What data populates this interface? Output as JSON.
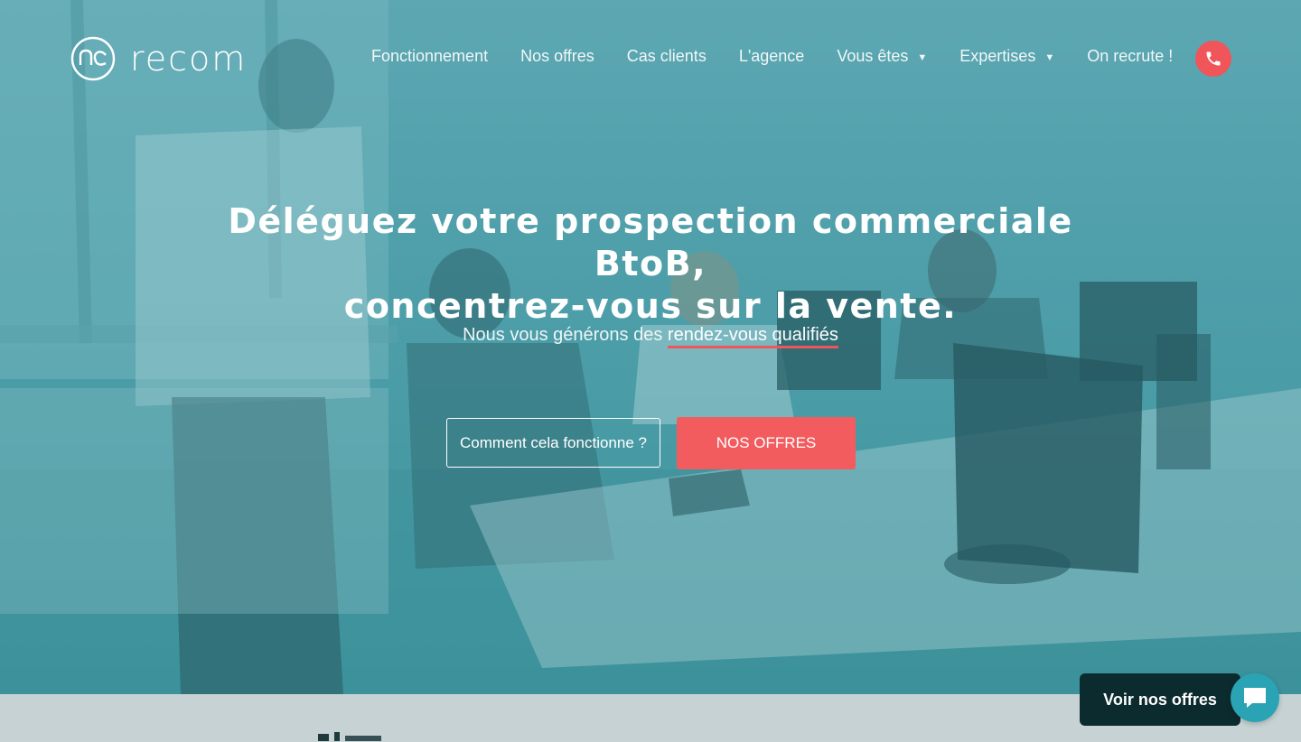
{
  "brand": {
    "name": "recom",
    "accent": "#f05659",
    "teal": "#4e9da6"
  },
  "nav": {
    "items": [
      {
        "label": "Fonctionnement"
      },
      {
        "label": "Nos offres"
      },
      {
        "label": "Cas clients"
      },
      {
        "label": "L'agence"
      },
      {
        "label": "Vous êtes",
        "dropdown": true
      },
      {
        "label": "Expertises",
        "dropdown": true
      },
      {
        "label": "On recrute !"
      }
    ],
    "phone_icon": "phone-icon"
  },
  "hero": {
    "headline_line1": "Déléguez votre prospection commerciale BtoB,",
    "headline_line2": "concentrez-vous sur la vente.",
    "sub_prefix": "Nous vous générons des ",
    "sub_highlight": "rendez-vous qualifiés",
    "btn_secondary": "Comment cela fonctionne ?",
    "btn_primary": "NOS OFFRES"
  },
  "chat": {
    "cta_label": "Voir nos offres",
    "icon": "chat-icon"
  }
}
